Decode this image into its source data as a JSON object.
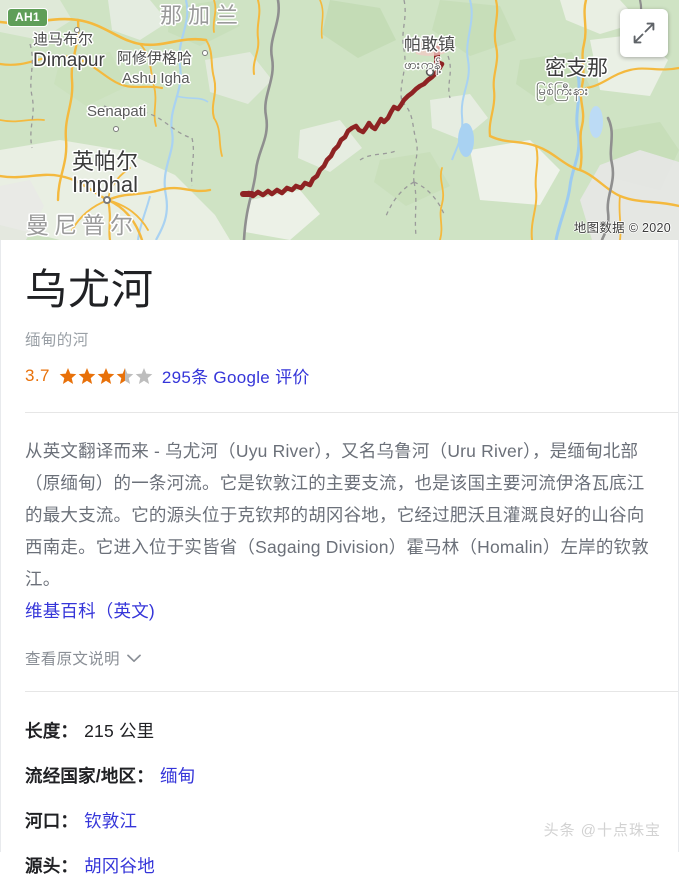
{
  "map": {
    "highway_badge": "AH1",
    "attribution": "地图数据 © 2020",
    "expand_icon": "expand-arrows-icon",
    "labels": [
      {
        "name": "nagaland",
        "cn": "那加兰",
        "en": ""
      },
      {
        "name": "dimapur",
        "cn": "迪马布尔",
        "en": "Dimapur"
      },
      {
        "name": "ashu-igha",
        "cn": "阿修伊格哈",
        "en": "Ashu Igha"
      },
      {
        "name": "senapati",
        "cn": "",
        "en": "Senapati"
      },
      {
        "name": "imphal",
        "cn": "英帕尔",
        "en": "Imphal"
      },
      {
        "name": "manipur",
        "cn": "曼尼普尔",
        "en": ""
      },
      {
        "name": "hpakant",
        "cn": "帕敢镇",
        "en": "ဖားကန့်"
      },
      {
        "name": "myitkyina",
        "cn": "密支那",
        "en": "မြစ်ကြီးနား"
      }
    ],
    "colors": {
      "land": "#cfe3c4",
      "river_highlight": "#8e2323",
      "road": "#f4b93e",
      "water": "#a9d2f2",
      "badge_green": "#5f9e58"
    }
  },
  "header": {
    "title": "乌尤河",
    "subtitle": "缅甸的河",
    "rating_value": "3.7",
    "rating_stars_filled": 3.5,
    "rating_stars_total": 5,
    "reviews_label": "295条 Google 评价",
    "star_color": "#e8710a",
    "star_empty_color": "#bdbdbd",
    "link_color": "#3535d9"
  },
  "description": {
    "text": "从英文翻译而来 - 乌尤河（Uyu River），又名乌鲁河（Uru River），是缅甸北部（原缅甸）的一条河流。它是钦敦江的主要支流，也是该国主要河流伊洛瓦底江的最大支流。它的源头位于克钦邦的胡冈谷地，它经过肥沃且灌溉良好的山谷向西南走。它进入位于实皆省（Sagaing Division）霍马林（Homalin）左岸的钦敦江。",
    "source_link": "维基百科（英文)",
    "show_original_label": "查看原文说明",
    "chevron_icon": "chevron-down-icon"
  },
  "facts": [
    {
      "label": "长度",
      "colon": "：",
      "value": "215 公里",
      "is_link": false
    },
    {
      "label": "流经国家/地区",
      "colon": "：",
      "value": "缅甸",
      "is_link": true
    },
    {
      "label": "河口",
      "colon": "：",
      "value": "钦敦江",
      "is_link": true
    },
    {
      "label": "源头",
      "colon": "：",
      "value": "胡冈谷地",
      "is_link": true
    }
  ],
  "watermark": "头条 @十点珠宝"
}
